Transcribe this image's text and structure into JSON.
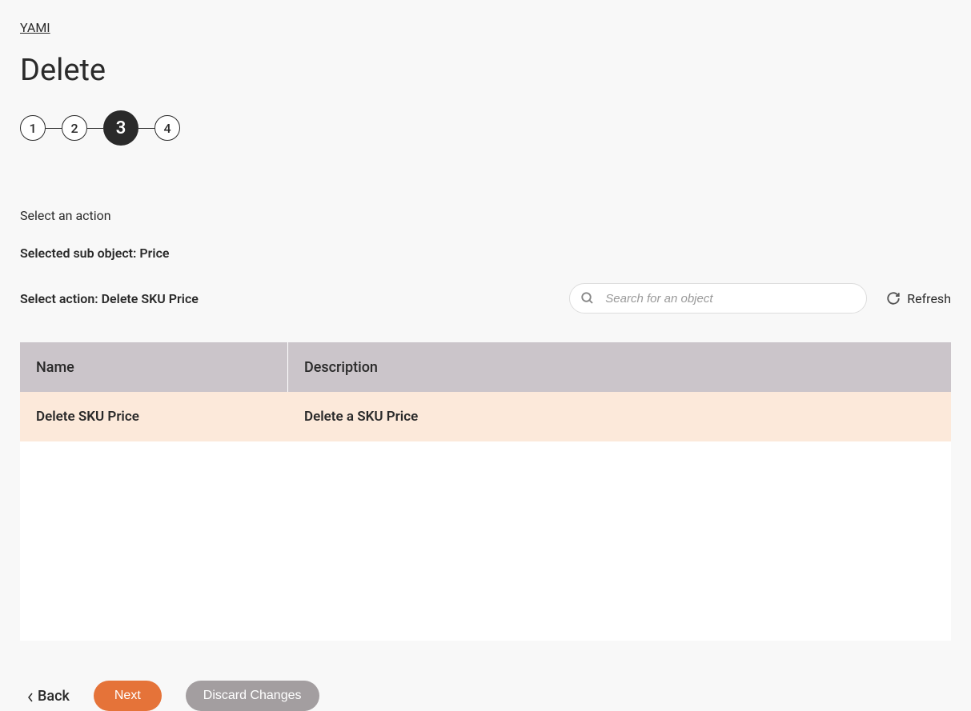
{
  "breadcrumb": "YAMI",
  "page_title": "Delete",
  "stepper": {
    "steps": [
      "1",
      "2",
      "3",
      "4"
    ],
    "active_index": 2
  },
  "instruction": "Select an action",
  "selected_sub_object": "Selected sub object: Price",
  "selected_action": "Select action: Delete SKU Price",
  "search": {
    "placeholder": "Search for an object",
    "value": ""
  },
  "refresh_label": "Refresh",
  "table": {
    "headers": {
      "name": "Name",
      "description": "Description"
    },
    "rows": [
      {
        "name": "Delete SKU Price",
        "description": "Delete a SKU Price"
      }
    ]
  },
  "buttons": {
    "back": "Back",
    "next": "Next",
    "discard": "Discard Changes"
  }
}
